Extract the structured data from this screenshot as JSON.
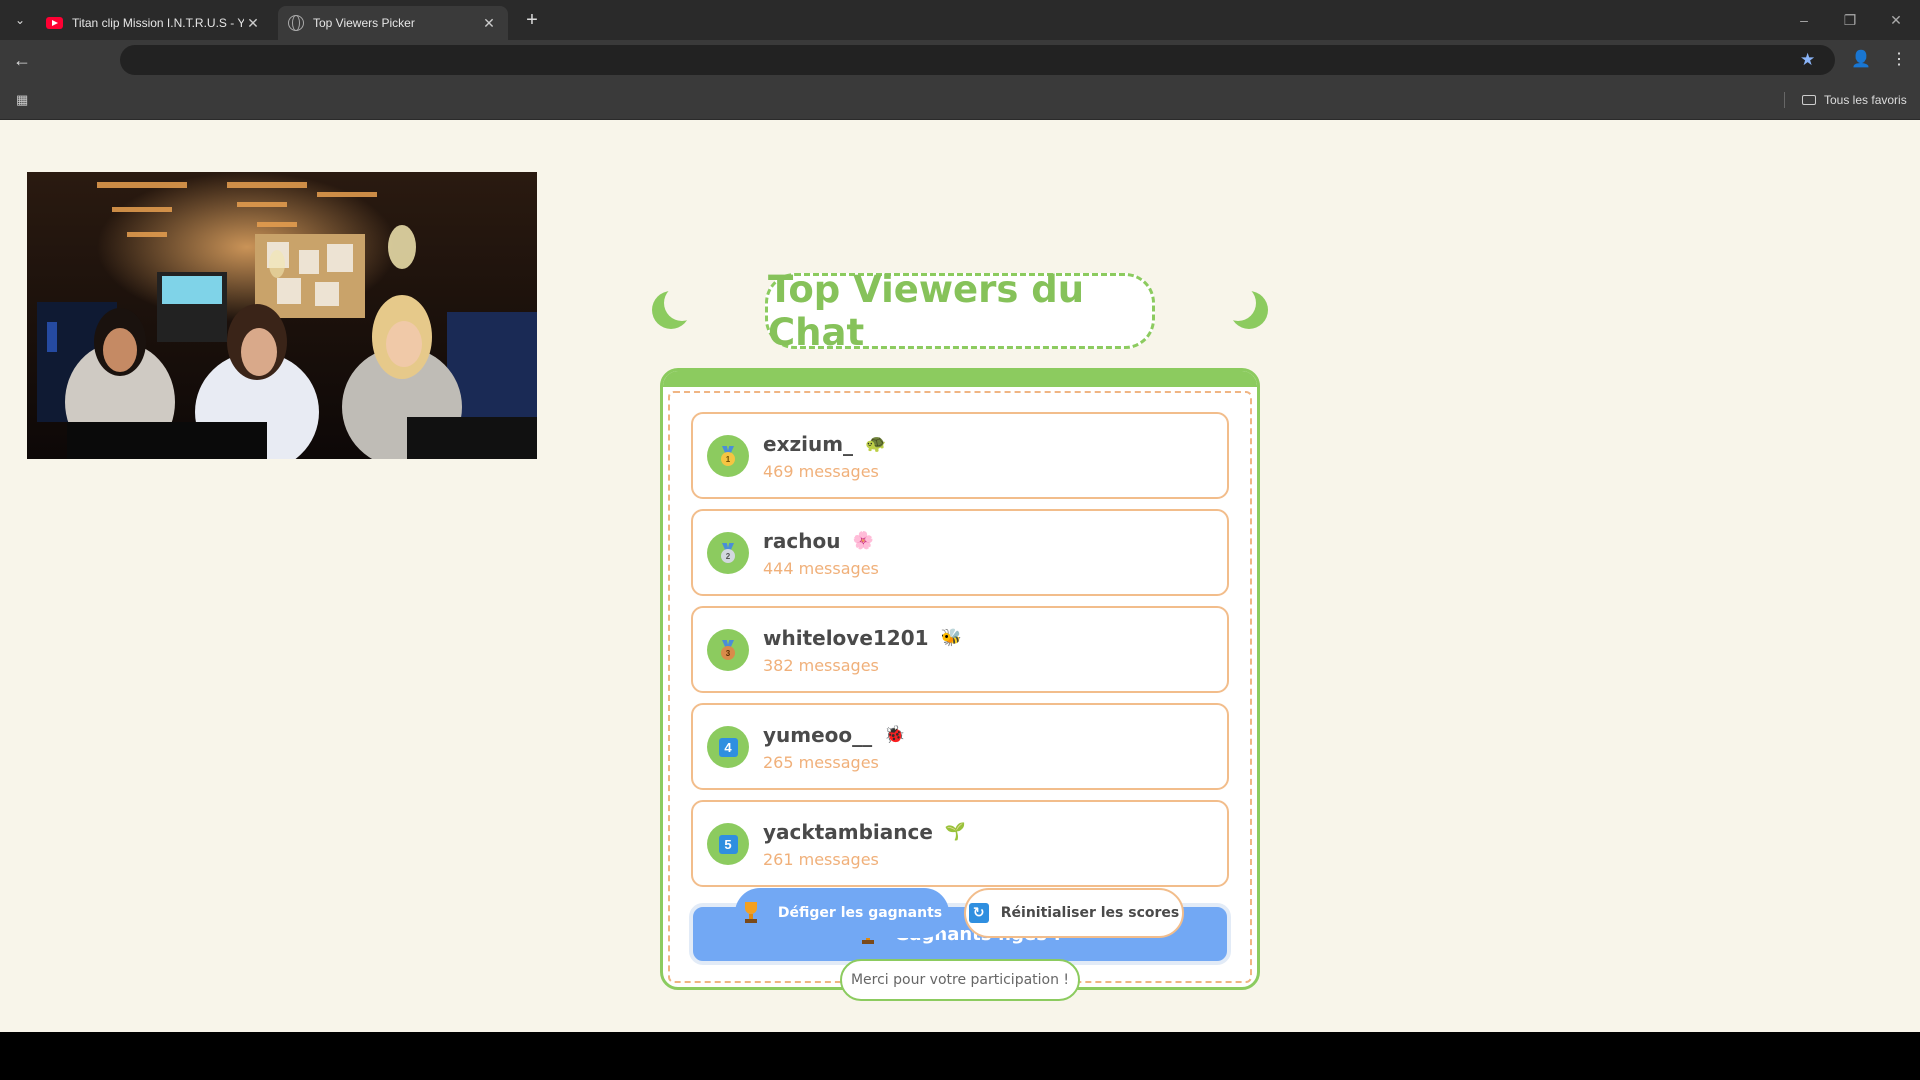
{
  "browser": {
    "tabs": [
      {
        "title": "Titan clip Mission I.N.T.R.U.S - Y",
        "icon": "youtube-icon"
      },
      {
        "title": "Top Viewers Picker",
        "icon": "globe-icon"
      }
    ],
    "bookmarks_all": "Tous les favoris"
  },
  "page": {
    "title": "Top Viewers du Chat",
    "viewers": [
      {
        "name": "exzium_",
        "count": "469 messages",
        "badge": "medal-gold",
        "rank": "1",
        "emoji": "🐢"
      },
      {
        "name": "rachou",
        "count": "444 messages",
        "badge": "medal-silver",
        "rank": "2",
        "emoji": "🌸"
      },
      {
        "name": "whitelove1201",
        "count": "382 messages",
        "badge": "medal-bronze",
        "rank": "3",
        "emoji": "🐝"
      },
      {
        "name": "yumeoo__",
        "count": "265 messages",
        "badge": "number",
        "rank": "4",
        "emoji": "🐞"
      },
      {
        "name": "yacktambiance",
        "count": "261 messages",
        "badge": "number",
        "rank": "5",
        "emoji": "🌱"
      }
    ],
    "frozen_label": "Gagnants figés !",
    "defreeze_label": "Défiger les gagnants",
    "reset_label": "Réinitialiser les scores",
    "thanks_label": "Merci pour votre participation !"
  },
  "colors": {
    "green": "#8ccb5f",
    "orange": "#f2bd8b",
    "blue": "#72a8f4",
    "background": "#f8f5ea"
  }
}
